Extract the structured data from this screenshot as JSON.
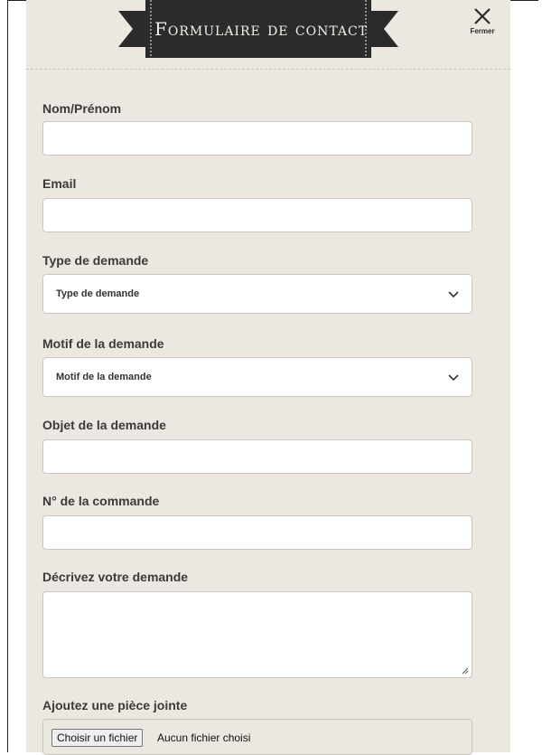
{
  "header": {
    "title": "Formulaire de contact",
    "close_label": "Fermer"
  },
  "form": {
    "name_label": "Nom/Prénom",
    "name_value": "",
    "email_label": "Email",
    "email_value": "",
    "request_type_label": "Type de demande",
    "request_type_selected": "Type de demande",
    "reason_label": "Motif de la demande",
    "reason_selected": "Motif de la demande",
    "subject_label": "Objet de la demande",
    "subject_value": "",
    "order_label": "N° de la commande",
    "order_value": "",
    "description_label": "Décrivez votre demande",
    "description_value": "",
    "attachment_label": "Ajoutez une pièce jointe",
    "file_button_label": "Choisir un fichier",
    "file_status": "Aucun fichier choisi"
  },
  "colors": {
    "panel_background": "#ece7e0",
    "banner": "#2b2b2b",
    "banner_text": "#f4efe7"
  },
  "icons": {
    "close": "close-icon",
    "dropdown": "chevron-down-icon",
    "resize": "resize-handle-icon"
  }
}
